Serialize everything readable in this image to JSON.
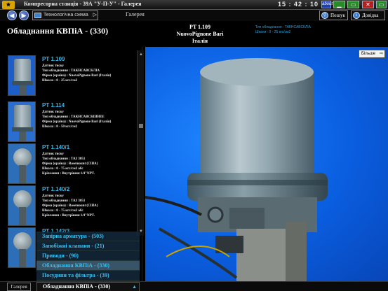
{
  "titlebar": {
    "logo_text": "🟊",
    "title": "Компресорна станція - 39А \"У-П-У\" -      Галерея",
    "time": "15 : 42 : 10",
    "about_label": "about"
  },
  "nav": {
    "breadcrumb": "Технологічна схема",
    "gallery_label": "Галерея",
    "search_label": "Пошук",
    "help_label": "Довідка"
  },
  "header": {
    "page_title": "Обладнання КВПіА - (330)",
    "selected_name": "PT 1.109",
    "selected_maker": "NuovoPignone Bari",
    "selected_country": "Італія",
    "right_line1": "Тип обладнання : ТАКНСАВСКЛІА",
    "right_line2": "Шкали : 0 - 25 кгс/см2"
  },
  "gallery": {
    "items": [
      {
        "name": "PT 1.109",
        "l1": "Датчик тиску",
        "l2": "Тип обладнання : ТАКНСАВСКЛІА",
        "l3": "Фірма (країна) : NuovoPignone Bari (Італія)",
        "l4": "Шкала : 0 - 25 кгс/см2",
        "l5": ""
      },
      {
        "name": "PT 1.114",
        "l1": "Датчик тиску",
        "l2": "Тип обладнання : ТАКНСАВСКШНЕЕ",
        "l3": "Фірма (країна) : NuovoPignone Bari (Італія)",
        "l4": "Шкала : 0 - 50 кгс/см2",
        "l5": ""
      },
      {
        "name": "PT 1.140/1",
        "l1": "Датчик тиску",
        "l2": "Тип обладнання : ТАЗ 3051",
        "l3": "Фірма (країна) : Rosemount (США)",
        "l4": "Шкала : 0 - 75 кгс/см2 абс",
        "l5": "Кріплення : Внутрішня 1/4\"NPT."
      },
      {
        "name": "PT 1.140/2",
        "l1": "Датчик тиску",
        "l2": "Тип обладнання : ТАЗ 3051",
        "l3": "Фірма (країна) : Rosemount (США)",
        "l4": "Шкала : 0 - 75 кгс/см2 абс",
        "l5": "Кріплення : Внутрішня 1/4\"NPT."
      },
      {
        "name": "PT 1.142/3",
        "l1": "",
        "l2": "",
        "l3": "",
        "l4": "",
        "l5": ""
      }
    ]
  },
  "categories": [
    "Запірна арматура - (503)",
    "Запобіжні клапани - (21)",
    "Приводи - (90)",
    "Обладнання КВПіА - (330)",
    "Посудини та фільтра - (39)"
  ],
  "bottom": {
    "gallery_button": "Галерея",
    "selected_category": "Обладнання КВПіА - (330)"
  },
  "photo": {
    "more_label": "Більше"
  },
  "colors": {
    "accent": "#35b7ec",
    "photo_bg": "#0a5ee0"
  }
}
